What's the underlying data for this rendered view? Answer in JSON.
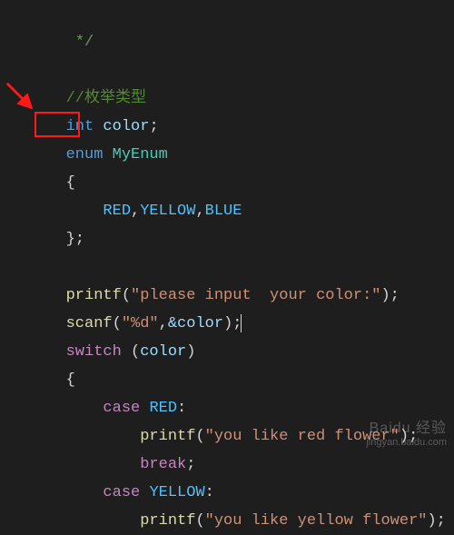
{
  "code": {
    "end_comment": "*/",
    "cn_comment": "//枚举类型",
    "int_kw": "int",
    "color_var": "color",
    "enum_kw": "enum",
    "enum_name": "MyEnum",
    "lbrace": "{",
    "red": "RED",
    "yellow": "YELLOW",
    "blue": "BLUE",
    "rbrace": "};",
    "printf": "printf",
    "prompt_str": "\"please input  your color:\"",
    "scanf": "scanf",
    "fmt_str": "\"%d\"",
    "amp_color": "&color",
    "switch_kw": "switch",
    "color_arg": "color",
    "case_kw": "case",
    "red_case": "RED",
    "red_msg": "\"you like red flower\"",
    "break_kw": "break",
    "yellow_case": "YELLOW",
    "yellow_msg": "\"you like yellow flower\""
  },
  "watermark": {
    "brand": "Baidu 经验",
    "url": "jingyan.baidu.com"
  }
}
